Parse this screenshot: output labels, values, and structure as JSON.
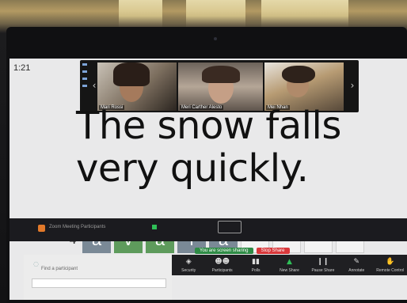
{
  "clock": "1:21",
  "video_strip": {
    "participants": [
      {
        "name": "Mari Rossi"
      },
      {
        "name": "Meri Carther Alesto"
      },
      {
        "name": "Mei Nhan"
      }
    ]
  },
  "caption": {
    "line1": "The snow falls",
    "line2": "very quickly."
  },
  "word_row": {
    "number": "4",
    "letters": [
      {
        "char": "a",
        "state": "grey"
      },
      {
        "char": "v",
        "state": "green"
      },
      {
        "char": "a",
        "state": "green"
      },
      {
        "char": "l",
        "state": "grey"
      },
      {
        "char": "a",
        "state": "grey"
      },
      {
        "char": "",
        "state": "empty"
      },
      {
        "char": "",
        "state": "empty"
      },
      {
        "char": "",
        "state": "empty"
      },
      {
        "char": "",
        "state": "empty"
      }
    ]
  },
  "share_banner": {
    "status": "You are screen sharing",
    "stop_label": "Stop Share"
  },
  "toolbar": {
    "items": [
      {
        "label": "Security",
        "icon": "shield-icon"
      },
      {
        "label": "Participants",
        "icon": "participants-icon"
      },
      {
        "label": "Polls",
        "icon": "polls-icon"
      },
      {
        "label": "New Share",
        "icon": "share-icon"
      },
      {
        "label": "Pause Share",
        "icon": "pause-icon"
      },
      {
        "label": "Annotate",
        "icon": "pen-icon"
      },
      {
        "label": "Remote Control",
        "icon": "remote-icon"
      }
    ]
  },
  "chat": {
    "hint": "Find a participant"
  },
  "taskbar": {
    "app_text": "Zoom Meeting Participants"
  },
  "colors": {
    "green_tile": "#5e9b5c",
    "grey_tile": "#7a8996",
    "share_green": "#2e8b45",
    "stop_red": "#d9383b"
  }
}
